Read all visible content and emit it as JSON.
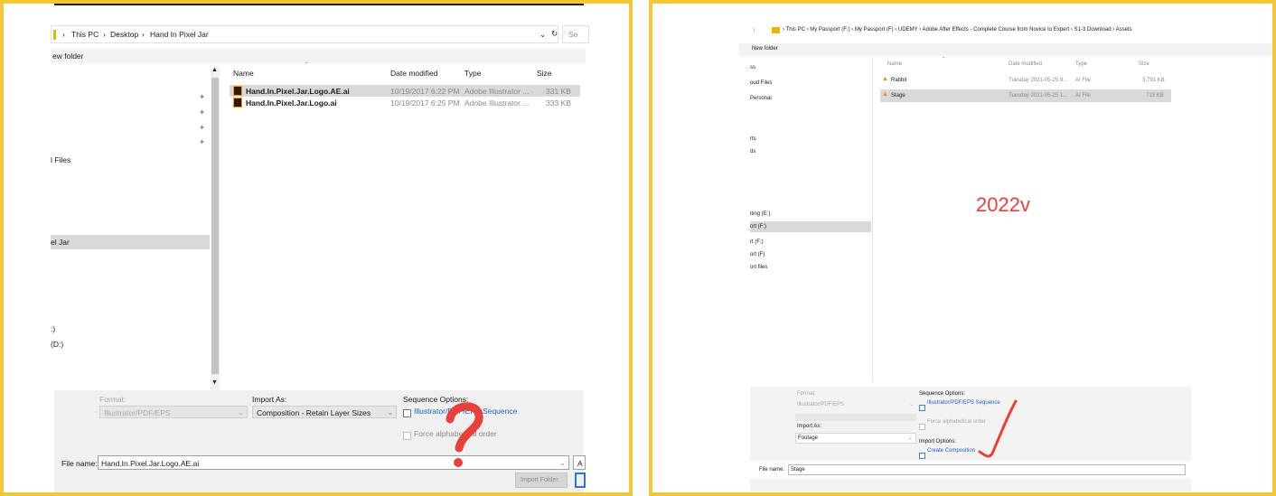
{
  "left": {
    "breadcrumb": [
      "This PC",
      "Desktop",
      "Hand In Pixel Jar"
    ],
    "search_placeholder": "Se",
    "new_folder": "ew folder",
    "sidebar": [
      "l Files",
      "el Jar",
      ":)",
      "(D:)"
    ],
    "columns": [
      "Name",
      "Date modified",
      "Type",
      "Size"
    ],
    "files": [
      {
        "name": "Hand.In.Pixel.Jar.Logo.AE.ai",
        "date": "10/19/2017 6:22 PM",
        "type": "Adobe Illustrator ...",
        "size": "331 KB"
      },
      {
        "name": "Hand.In.Pixel.Jar.Logo.ai",
        "date": "10/19/2017 6:25 PM",
        "type": "Adobe Illustrator ...",
        "size": "333 KB"
      }
    ],
    "format_label": "Format:",
    "format_value": "Illustrator/PDF/EPS",
    "import_as_label": "Import As:",
    "import_as_value": "Composition - Retain Layer Sizes",
    "seq_label": "Sequence Options:",
    "seq_checkbox": "Illustrator/PDF/EPS Sequence",
    "force_alpha": "Force alphabetical order",
    "filename_label": "File name:",
    "filename_value": "Hand.In.Pixel.Jar.Logo.AE.ai",
    "import_folder": "Import Folder",
    "right_cut": "A"
  },
  "right": {
    "breadcrumb": [
      "This PC",
      "My Passport (F:)",
      "My Passport (F)",
      "UDEMY",
      "Adobe After Effects - Complete Course from Novice to Expert",
      "S1-3 Download",
      "Assets"
    ],
    "new_folder": "New folder",
    "sidebar": [
      "ss",
      "oud Files",
      "Personal",
      "rts",
      "ds",
      "iting (E:)",
      "ort (F:)",
      "rt (F:)",
      "ort (F)",
      "ort files"
    ],
    "columns": [
      "Name",
      "Date modified",
      "Type",
      "Size"
    ],
    "files": [
      {
        "name": "Rabbit",
        "date": "Tuesday  2021-05-25 9...",
        "type": "AI File",
        "size": "3,791 KB"
      },
      {
        "name": "Stage",
        "date": "Tuesday  2021-05-25 1...",
        "type": "AI File",
        "size": "713 KB"
      }
    ],
    "annotation": "2022v",
    "format_label": "Format:",
    "format_value": "Illustrator/PDF/EPS",
    "import_as_label": "Import As:",
    "import_as_value": "Footage",
    "seq_label": "Sequence Options:",
    "seq_checkbox": "Illustrator/PDF/EPS Sequence",
    "force_alpha": "Force alphabetical order",
    "import_options_label": "Import Options:",
    "create_comp": "Create Composition",
    "filename_label": "File name:",
    "filename_value": "Stage"
  },
  "colors": {
    "frame": "#f2c636",
    "annotation_red": "#e8403a",
    "selection": "#d9d9d9",
    "link_blue": "#1f5fbf"
  }
}
